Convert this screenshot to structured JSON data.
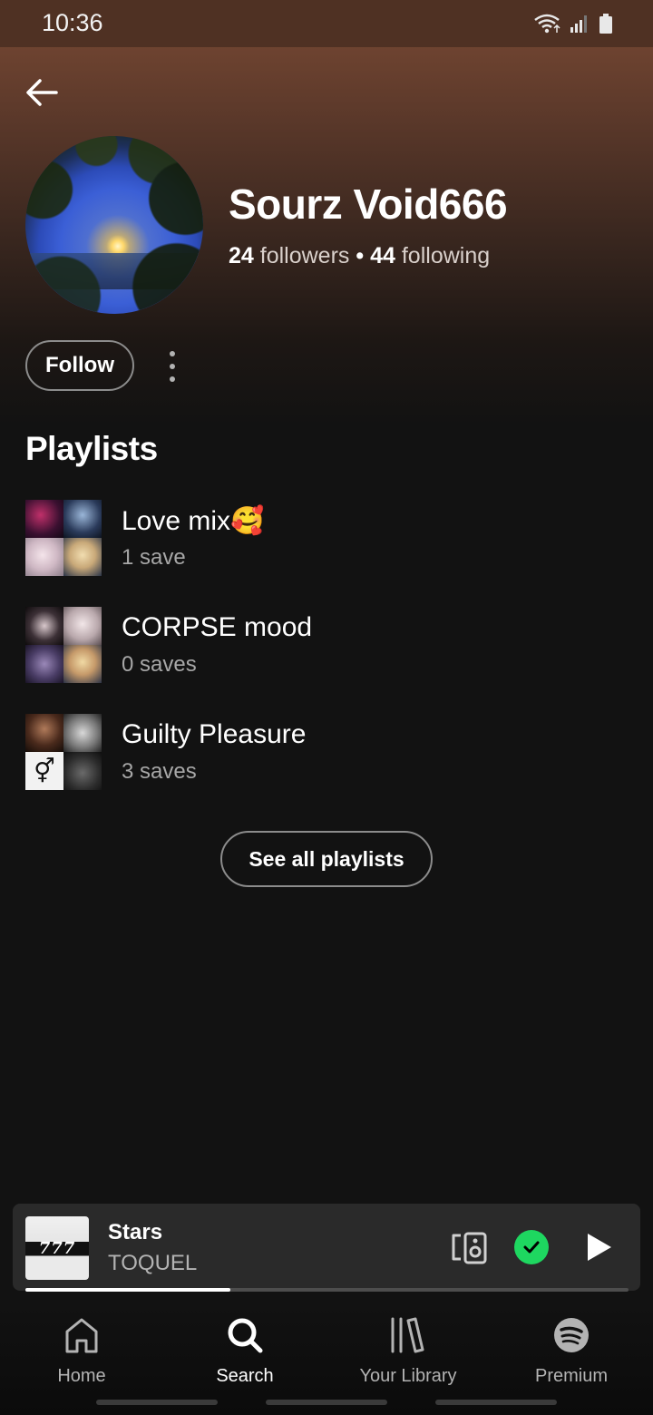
{
  "status_bar": {
    "time": "10:36"
  },
  "profile": {
    "name": "Sourz Void666",
    "followers_count": "24",
    "followers_label": "followers",
    "separator": "•",
    "following_count": "44",
    "following_label": "following",
    "follow_button": "Follow"
  },
  "playlists_section": {
    "title": "Playlists",
    "items": [
      {
        "name": "Love mix🥰",
        "subtitle": "1 save"
      },
      {
        "name": "CORPSE mood",
        "subtitle": "0 saves"
      },
      {
        "name": "Guilty Pleasure",
        "subtitle": "3 saves"
      }
    ],
    "see_all_button": "See all playlists"
  },
  "now_playing": {
    "title": "Stars",
    "artist": "TOQUEL",
    "cover_text": "777",
    "progress_fraction": 0.34,
    "saved": true
  },
  "bottom_nav": {
    "items": [
      {
        "label": "Home",
        "icon": "home-icon"
      },
      {
        "label": "Search",
        "icon": "search-icon",
        "active": true
      },
      {
        "label": "Your Library",
        "icon": "library-icon"
      },
      {
        "label": "Premium",
        "icon": "spotify-logo-icon"
      }
    ]
  },
  "colors": {
    "accent_green": "#1ed760",
    "background": "#121212",
    "header_brown": "#7a4a34"
  }
}
